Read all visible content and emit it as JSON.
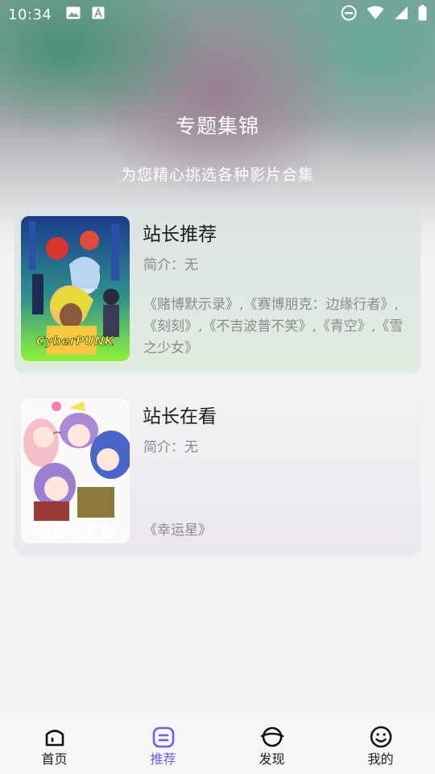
{
  "status_bar": {
    "time": "10:34"
  },
  "hero": {
    "title": "专题集锦",
    "subtitle": "为您精心挑选各种影片合集"
  },
  "cards": [
    {
      "title": "站长推荐",
      "intro": "简介：无",
      "list": "《赌博默示录》,《赛博朋克：边缘行者》,《刻刻》,《不吉波普不笑》,《青空》,《雪之少女》",
      "poster_logo": "CyberPUNK",
      "poster_icon": "cyberpunk-poster"
    },
    {
      "title": "站长在看",
      "intro": "简介：无",
      "list": "《幸运星》",
      "poster_logo": "らき☆すた",
      "poster_icon": "lucky-star-poster"
    }
  ],
  "tabbar": {
    "items": [
      {
        "label": "首页",
        "icon": "home-icon",
        "active": false
      },
      {
        "label": "推荐",
        "icon": "recommend-icon",
        "active": true
      },
      {
        "label": "发现",
        "icon": "discover-icon",
        "active": false
      },
      {
        "label": "我的",
        "icon": "profile-icon",
        "active": false
      }
    ],
    "active_color": "#6b5ef0"
  }
}
